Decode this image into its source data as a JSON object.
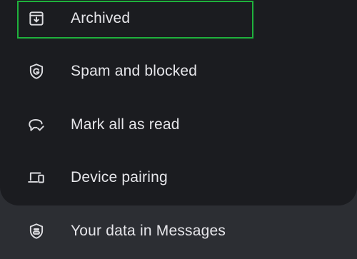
{
  "menu": {
    "items": [
      {
        "label": "Archived",
        "icon": "archive-icon",
        "highlighted": true
      },
      {
        "label": "Spam and blocked",
        "icon": "shield-g-icon"
      },
      {
        "label": "Mark all as read",
        "icon": "chat-check-icon"
      },
      {
        "label": "Device pairing",
        "icon": "devices-icon"
      },
      {
        "label": "Your data in Messages",
        "icon": "shield-toggle-icon"
      }
    ]
  },
  "colors": {
    "panel_background": "#1b1c20",
    "page_background": "#2c2e33",
    "text": "#e6e6ea",
    "highlight_border": "#1fb13c"
  }
}
